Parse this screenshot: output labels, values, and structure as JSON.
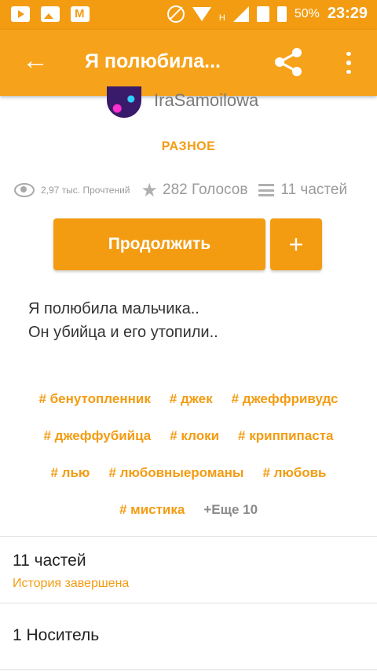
{
  "status_bar": {
    "battery": "50%",
    "time": "23:29",
    "network": "H",
    "icons": [
      "youtube-icon",
      "gallery-icon",
      "mail-icon",
      "no-disturb-icon",
      "wifi-icon",
      "signal-icon",
      "sim-icon",
      "battery-icon"
    ]
  },
  "app_bar": {
    "title": "Я полюбила...",
    "back_icon": "←",
    "share_icon": "share-icon",
    "menu_icon": "more-vertical-icon"
  },
  "author": {
    "name": "IraSamoilowa"
  },
  "category": "РАЗНОЕ",
  "stats": {
    "reads": "2,97 тыс. Прочтений",
    "votes": "282 Голосов",
    "parts": "11 частей"
  },
  "buttons": {
    "continue": "Продолжить",
    "add": "+"
  },
  "description": {
    "line1": "Я полюбила мальчика..",
    "line2": "Он убийца и его утопили.."
  },
  "tags": {
    "row1": [
      "# бенутопленник",
      "# джек",
      "# джеффривудс"
    ],
    "row2": [
      "# джеффубийца",
      "# клоки",
      "# криппипаста"
    ],
    "row3": [
      "# лью",
      "# любовныероманы",
      "# любовь"
    ],
    "row4": [
      "# мистика"
    ],
    "more": "+Еще 10"
  },
  "parts_section": {
    "title": "11 частей",
    "status": "История завершена"
  },
  "media_section": {
    "title": "1 Носитель"
  },
  "colors": {
    "accent": "#f39c12",
    "appbar": "#f6a21a"
  }
}
